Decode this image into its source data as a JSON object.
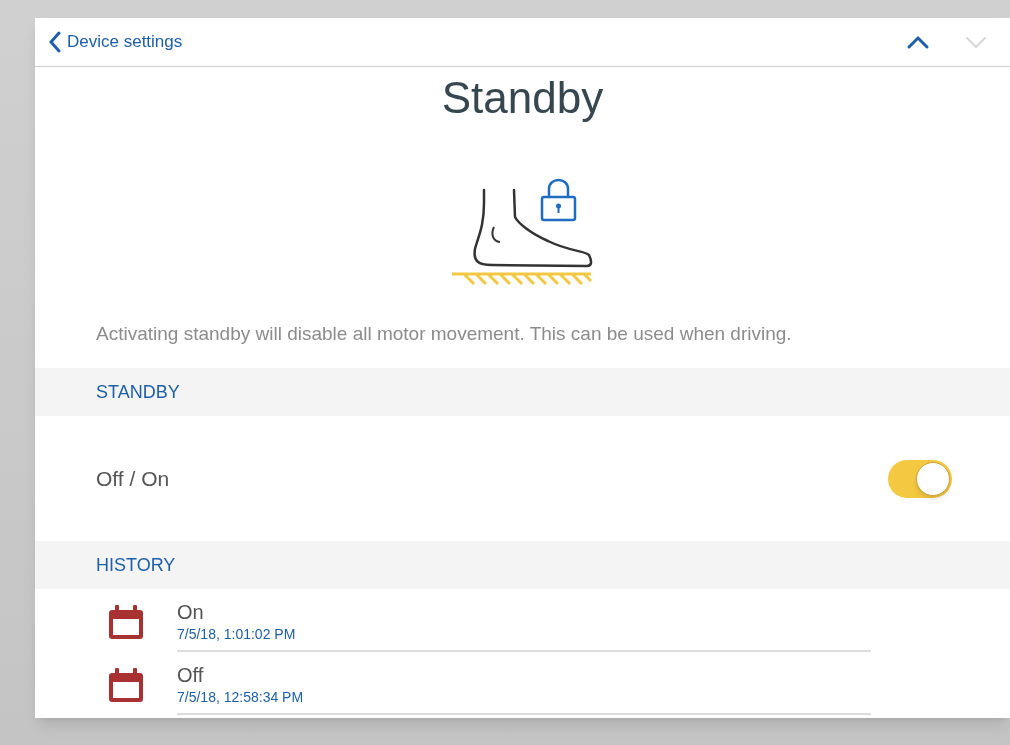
{
  "header": {
    "back_label": "Device settings",
    "nav": [
      {
        "kind": "up",
        "disabled": false
      },
      {
        "kind": "down",
        "disabled": true
      }
    ]
  },
  "title": "Standby",
  "description": "Activating standby will disable all motor movement. This can be used when driving.",
  "sections": [
    {
      "heading": "STANDBY",
      "kind": "toggle",
      "label": "Off / On",
      "on": true
    },
    {
      "heading": "HISTORY",
      "kind": "history",
      "entries": [
        {
          "state": "On",
          "time": "7/5/18, 1:01:02 PM"
        },
        {
          "state": "Off",
          "time": "7/5/18, 12:58:34 PM"
        }
      ]
    }
  ]
}
